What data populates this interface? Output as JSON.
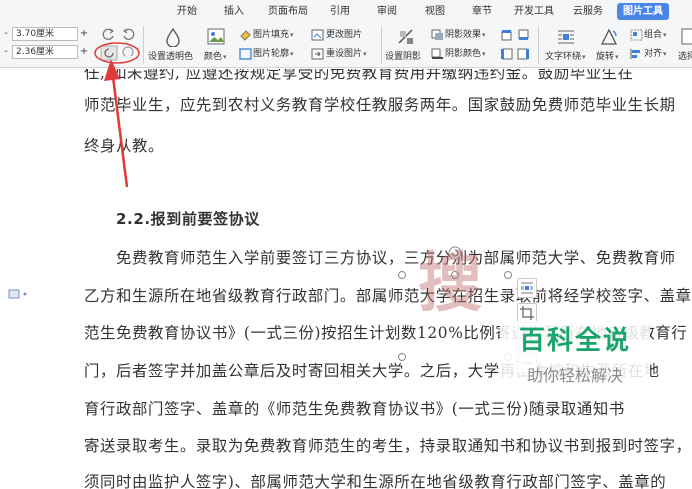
{
  "ribbon": {
    "tabs": [
      {
        "label": "开始"
      },
      {
        "label": "插入"
      },
      {
        "label": "页面布局"
      },
      {
        "label": "引用"
      },
      {
        "label": "审阅"
      },
      {
        "label": "视图"
      },
      {
        "label": "章节"
      },
      {
        "label": "开发工具"
      },
      {
        "label": "云服务"
      },
      {
        "label": "图片工具",
        "active": true
      }
    ],
    "height_value": "3.70厘米",
    "width_value": "2.36厘米",
    "minus": "-",
    "plus": "+",
    "transparency_label": "设置透明色",
    "color_label": "颜色",
    "image_fill_label": "图片填充",
    "image_outline_label": "图片轮廓",
    "change_image_label": "更改图片",
    "reset_image_label": "重设图片",
    "set_shadow_label": "设置阴影",
    "shadow_effect_label": "阴影效果",
    "shadow_color_label": "阴影颜色",
    "text_wrap_label": "文字环绕",
    "rotate_label": "旋转",
    "group_label": "组合",
    "align_label": "对齐",
    "select_label": "选择",
    "dropdown_glyph": "▾"
  },
  "document": {
    "lines": [
      "任,  如未遵约,  应遵还按规定享受的免费教育费用并缴纳违约金。鼓励毕业生在",
      "师范毕业生，应先到农村义务教育学校任教服务两年。国家鼓励免费师范毕业生长期",
      "终身从教。",
      "2.2.报到前要签协议",
      "免费教育师范生入学前要签订三方协议，三方分别为部属师范大学、免费教育师",
      "乙方和生源所在地省级教育行政部门。部属师范大学在招生录取前将经学校签字、盖章",
      "范生免费教育协议书》(一式三份)按招生计划数120%比例寄送生源所在地省级教育行",
      "门，后者签字并加盖公章后及时寄回相关大学。之后，大学再由本校和生源所在地",
      "育行政部门签字、盖章的《师范生免费教育协议书》(一式三份)随录取通知书",
      "寄送录取考生。录取为免费教育师范生的考生，持录取通知书和协议书到报到时签字，满18",
      "须同时由监护人签字)、部属师范大学和生源所在地省级教育行政部门签字、盖章的"
    ]
  },
  "watermark": {
    "char": "搜",
    "title": "百科全说",
    "subtitle": "助你轻松解决"
  },
  "colors": {
    "accent": "#4a86e8",
    "arrow": "#e03b3b",
    "watermark_green": "#1aa36a"
  }
}
